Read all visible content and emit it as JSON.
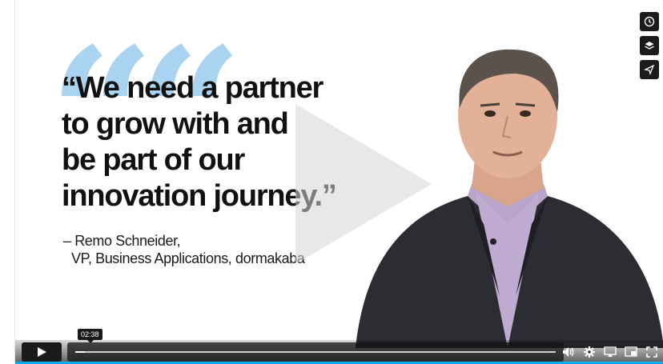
{
  "slide": {
    "quote_mark": "“",
    "quote_lines": [
      "“We need a partner",
      "to grow with and",
      "be part of our",
      "innovation journey.”"
    ],
    "attribution_line1": "– Remo Schneider,",
    "attribution_line2": "VP, Business Applications, dormakaba"
  },
  "controls": {
    "timestamp_tooltip": "02:38",
    "progress_fraction": 0.02,
    "side_tools": [
      "clock-icon",
      "layers-icon",
      "share-icon"
    ],
    "right_icons": [
      "volume-icon",
      "settings-icon",
      "airplay-icon",
      "pip-icon",
      "fullscreen-icon"
    ]
  },
  "colors": {
    "quote_mark": "#a9d3f0",
    "accent_bar": "#00adef",
    "text": "#111111"
  }
}
